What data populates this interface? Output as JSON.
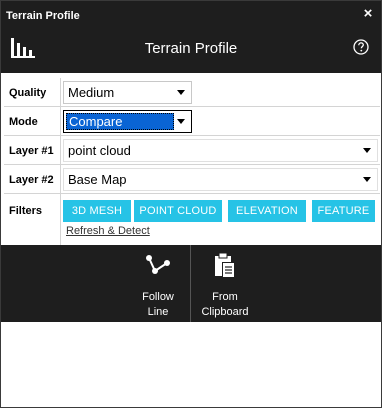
{
  "window": {
    "title": "Terrain Profile",
    "close_glyph": "×"
  },
  "header": {
    "title": "Terrain Profile",
    "logo_icon": "terrain-profile-logo-icon",
    "help_icon": "help-icon"
  },
  "form": {
    "quality": {
      "label": "Quality",
      "value": "Medium"
    },
    "mode": {
      "label": "Mode",
      "value": "Compare"
    },
    "layer1": {
      "label": "Layer #1",
      "value": "point cloud"
    },
    "layer2": {
      "label": "Layer #2",
      "value": "Base Map"
    },
    "filters": {
      "label": "Filters",
      "chips": [
        "3D MESH",
        "POINT CLOUD",
        "ELEVATION",
        "FEATURE"
      ],
      "chip_color": "#26c3e6"
    },
    "refresh_link": "Refresh & Detect"
  },
  "toolbar": {
    "follow_line": {
      "line1": "Follow",
      "line2": "Line",
      "icon": "follow-line-icon"
    },
    "from_clipboard": {
      "line1": "From",
      "line2": "Clipboard",
      "icon": "clipboard-icon"
    }
  },
  "colors": {
    "dark": "#1e1e1e",
    "accent": "#26c3e6",
    "selection": "#0a64d4"
  }
}
